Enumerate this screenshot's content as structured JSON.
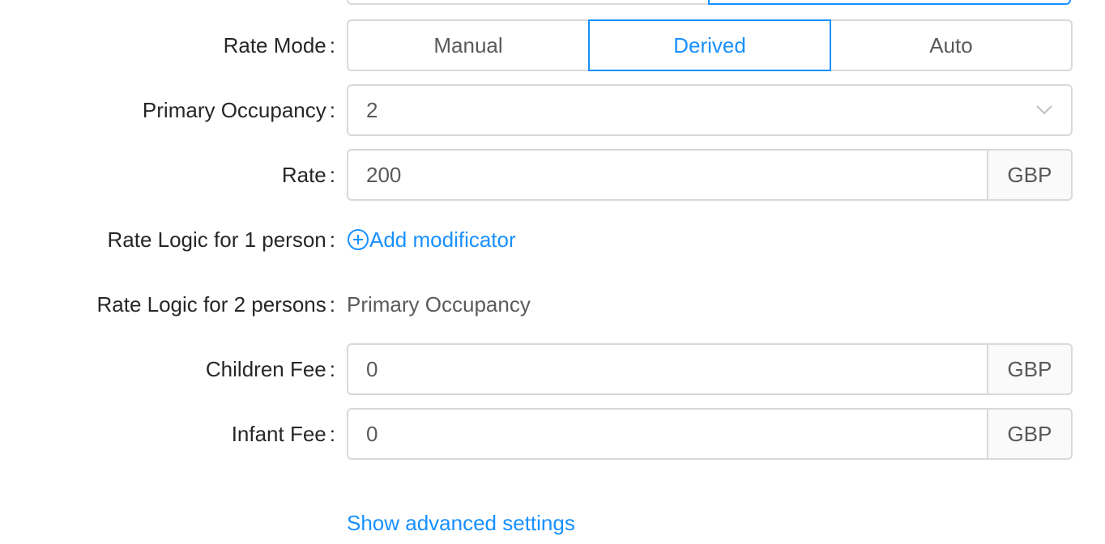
{
  "form": {
    "rate_mode": {
      "label": "Rate Mode",
      "options": [
        "Manual",
        "Derived",
        "Auto"
      ],
      "selected": "Derived"
    },
    "primary_occupancy": {
      "label": "Primary Occupancy",
      "value": "2",
      "icon": "chevron-down-icon"
    },
    "rate": {
      "label": "Rate",
      "value": "200",
      "currency": "GBP"
    },
    "rate_logic_1": {
      "label": "Rate Logic for 1 person",
      "link": "Add modificator",
      "icon": "plus-circle-icon"
    },
    "rate_logic_2": {
      "label": "Rate Logic for 2 persons",
      "value": "Primary Occupancy"
    },
    "children_fee": {
      "label": "Children Fee",
      "value": "0",
      "currency": "GBP"
    },
    "infant_fee": {
      "label": "Infant Fee",
      "value": "0",
      "currency": "GBP"
    },
    "colon": ":",
    "advanced_link": "Show advanced settings"
  },
  "colors": {
    "accent": "#1890ff",
    "border": "#d9d9d9",
    "addon_bg": "#fafafa"
  }
}
